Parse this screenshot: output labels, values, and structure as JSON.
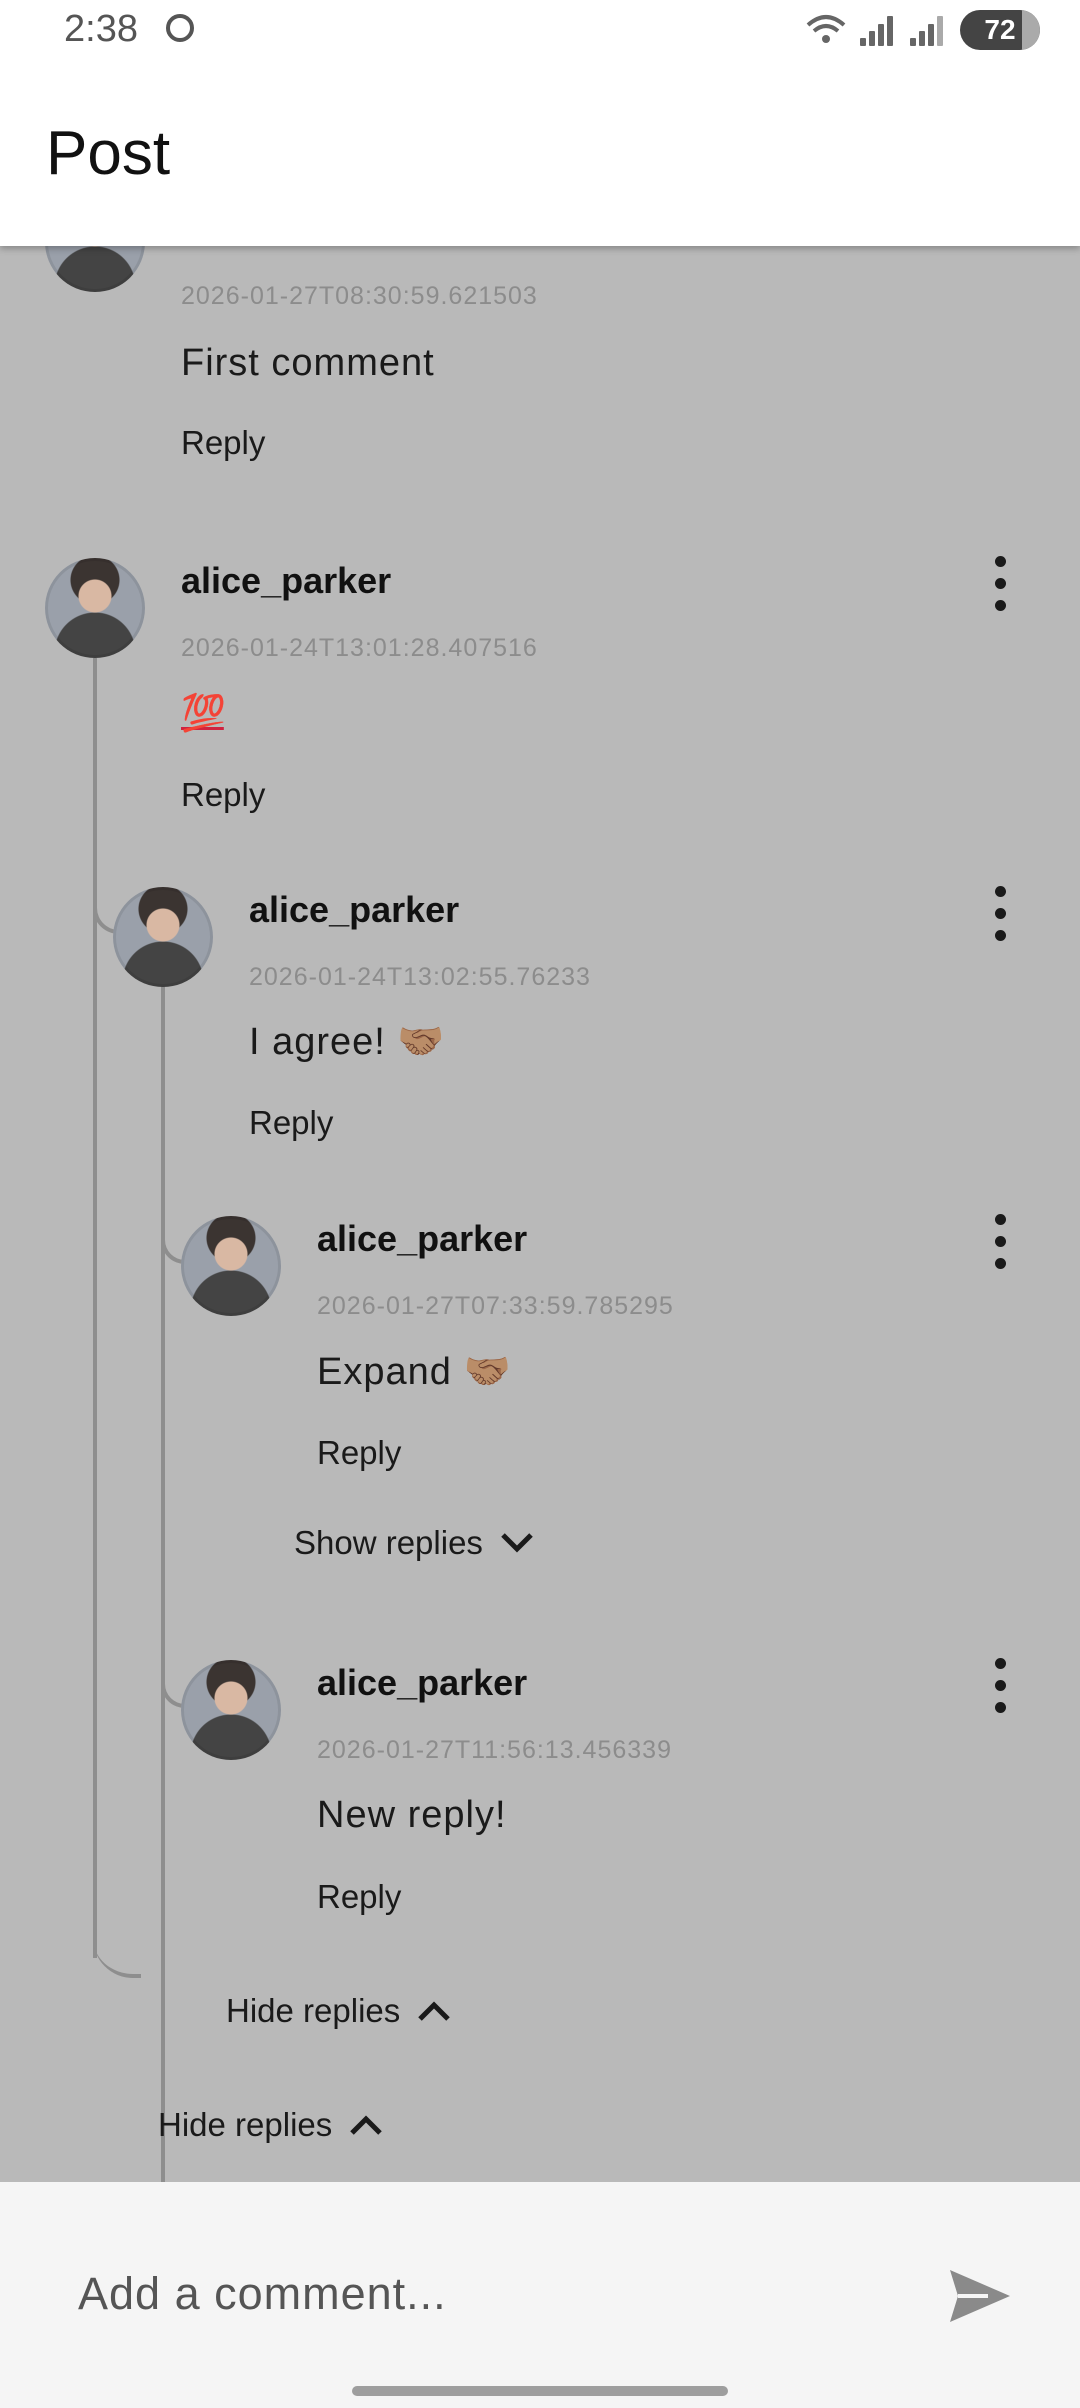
{
  "status_bar": {
    "time": "2:38",
    "battery": "72"
  },
  "app_bar": {
    "title": "Post"
  },
  "comments": [
    {
      "timestamp": "2026-01-27T08:30:59.621503",
      "text": "First comment",
      "reply_label": "Reply"
    },
    {
      "username": "alice_parker",
      "timestamp": "2026-01-24T13:01:28.407516",
      "text": "💯",
      "reply_label": "Reply"
    },
    {
      "username": "alice_parker",
      "timestamp": "2026-01-24T13:02:55.76233",
      "text": "I agree! 🤝🏽",
      "reply_label": "Reply"
    },
    {
      "username": "alice_parker",
      "timestamp": "2026-01-27T07:33:59.785295",
      "text": "Expand 🤝🏽",
      "reply_label": "Reply",
      "show_replies_label": "Show replies"
    },
    {
      "username": "alice_parker",
      "timestamp": "2026-01-27T11:56:13.456339",
      "text": "New reply!",
      "reply_label": "Reply"
    }
  ],
  "thread_controls": {
    "hide_replies_inner": "Hide replies",
    "hide_replies_outer": "Hide replies"
  },
  "composer": {
    "placeholder": "Add a comment..."
  },
  "icons": {
    "kebab": "more-vert-icon",
    "chevron_down": "chevron-down-icon",
    "chevron_up": "chevron-up-icon",
    "send": "send-icon"
  }
}
